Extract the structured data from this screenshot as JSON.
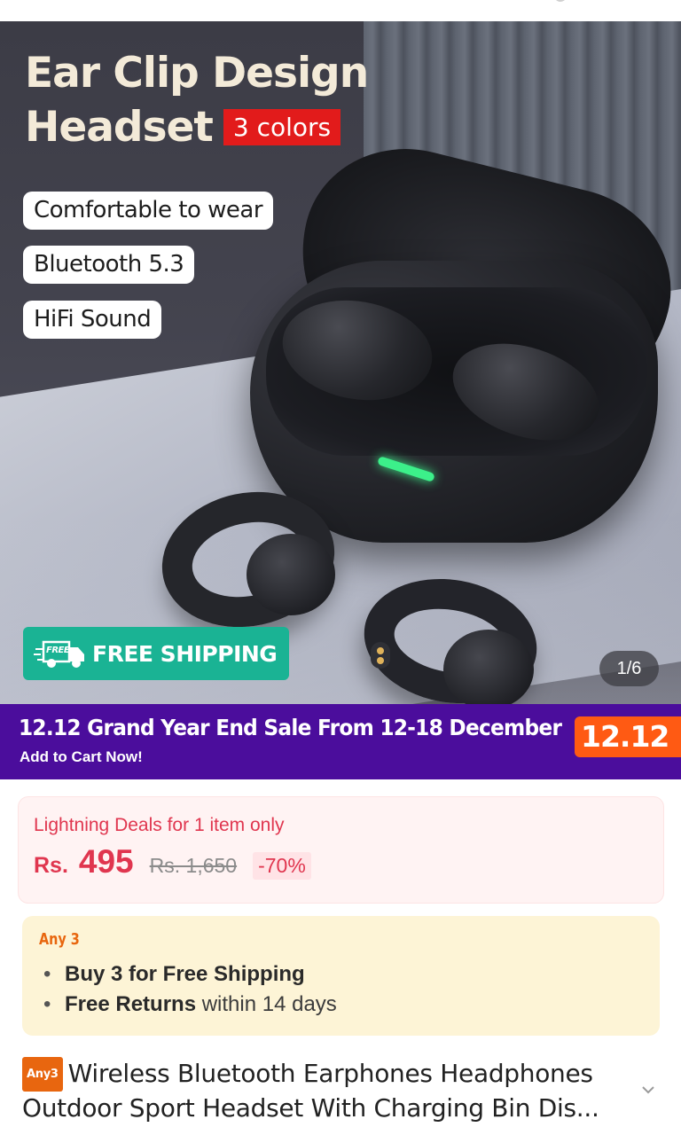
{
  "hero": {
    "title_line1": "Ear Clip Design",
    "title_line2": "Headset",
    "colors_badge": "3 colors",
    "features": [
      "Comfortable to wear",
      "Bluetooth 5.3",
      "HiFi Sound"
    ],
    "free_shipping": "FREE SHIPPING",
    "truck_badge": "FREE",
    "image_counter": "1/6"
  },
  "promo": {
    "title": "12.12 Grand Year End Sale From 12-18 December",
    "subtitle": "Add to Cart Now!",
    "badge": "12.12"
  },
  "price": {
    "deal_label": "Lightning Deals for 1 item only",
    "currency": "Rs.",
    "current": "495",
    "original": "Rs. 1,650",
    "discount": "-70%"
  },
  "offer": {
    "tag": "Any 3",
    "line1_bold": "Buy 3 for  Free Shipping",
    "line2_bold": "Free Returns",
    "line2_rest": " within 14 days"
  },
  "product": {
    "badge": "Any3",
    "title": "Wireless Bluetooth Earphones Headphones Outdoor Sport Headset With Charging Bin Dis..."
  },
  "colors": {
    "promo_bg": "#4b0d9c",
    "accent_red": "#e0364f",
    "free_ship_green": "#1ab394",
    "orange": "#e8660f"
  }
}
